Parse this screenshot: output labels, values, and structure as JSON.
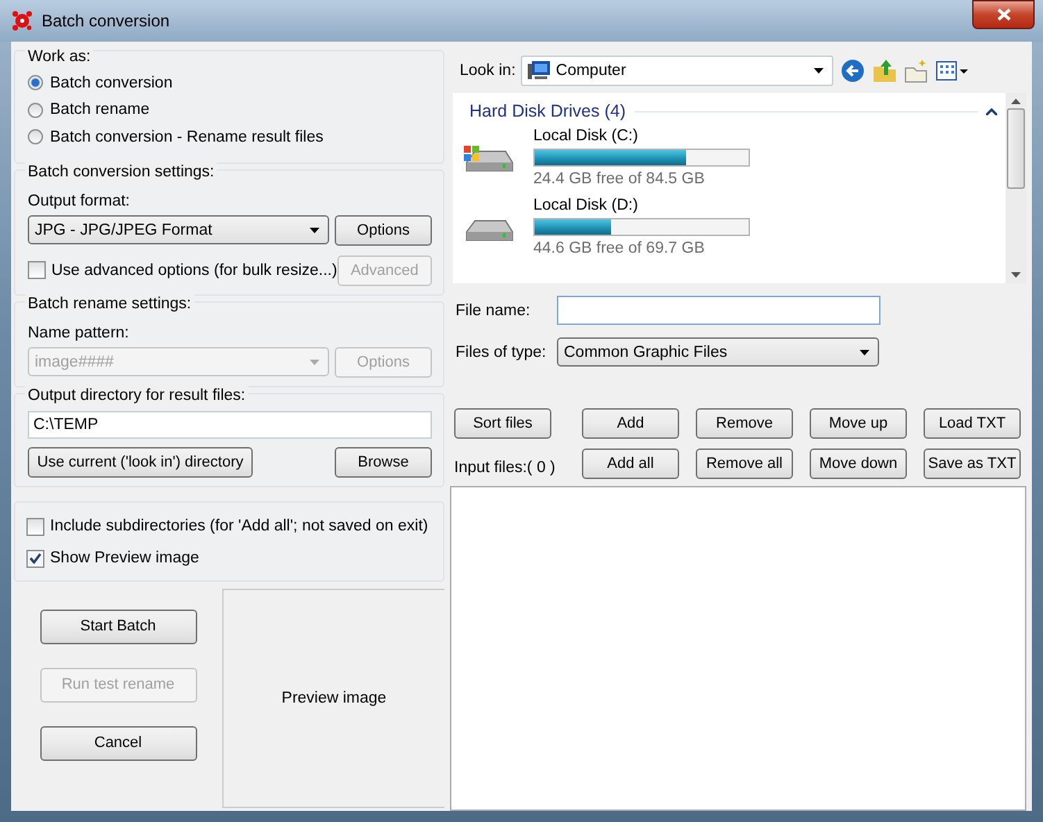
{
  "window": {
    "title": "Batch conversion"
  },
  "work_as": {
    "label": "Work as:",
    "options": [
      {
        "label": "Batch conversion",
        "selected": true
      },
      {
        "label": "Batch rename",
        "selected": false
      },
      {
        "label": "Batch conversion - Rename result files",
        "selected": false
      }
    ]
  },
  "conversion_settings": {
    "label": "Batch conversion settings:",
    "format_label": "Output format:",
    "format": "JPG - JPG/JPEG Format",
    "options_button": {
      "label": "Options",
      "disabled": false
    },
    "advanced_option": {
      "label": "Use advanced options (for bulk resize...)",
      "checked": false
    },
    "advanced_button": {
      "label": "Advanced",
      "disabled": true
    }
  },
  "rename_settings": {
    "label": "Batch rename settings:",
    "pattern_label": "Name pattern:",
    "pattern": {
      "value": "image####",
      "disabled": true
    },
    "options_button": {
      "label": "Options",
      "disabled": true
    }
  },
  "output_directory": {
    "label": "Output directory for result files:",
    "value": "C:\\TEMP",
    "use_current_button": "Use current ('look in') directory",
    "browse_button": "Browse"
  },
  "options": [
    {
      "label": "Include subdirectories (for 'Add all'; not saved on exit)",
      "checked": false
    },
    {
      "label": "Show Preview image",
      "checked": true
    }
  ],
  "actions": [
    {
      "label": "Start Batch",
      "disabled": false
    },
    {
      "label": "Run test rename",
      "disabled": true
    },
    {
      "label": "Cancel",
      "disabled": false
    }
  ],
  "preview": {
    "label": "Preview image"
  },
  "look_in": {
    "label": "Look in:",
    "value": "Computer"
  },
  "drives": {
    "group": "Hard Disk Drives (4)",
    "items": [
      {
        "name": "Local Disk (C:)",
        "level": 0.71,
        "free": "24.4 GB free of 84.5 GB",
        "kind": "system"
      },
      {
        "name": "Local Disk (D:)",
        "level": 0.36,
        "free": "44.6 GB free of 69.7 GB",
        "kind": "plain"
      }
    ]
  },
  "file_name": {
    "label": "File name:"
  },
  "file_type": {
    "label": "Files of type:",
    "value": "Common Graphic Files"
  },
  "file_buttons": [
    "Sort files",
    "Add",
    "Remove",
    "Move up",
    "Load TXT",
    "Add all",
    "Remove all",
    "Move down",
    "Save as TXT"
  ],
  "input_files": {
    "label": "Input files:( 0 )"
  }
}
